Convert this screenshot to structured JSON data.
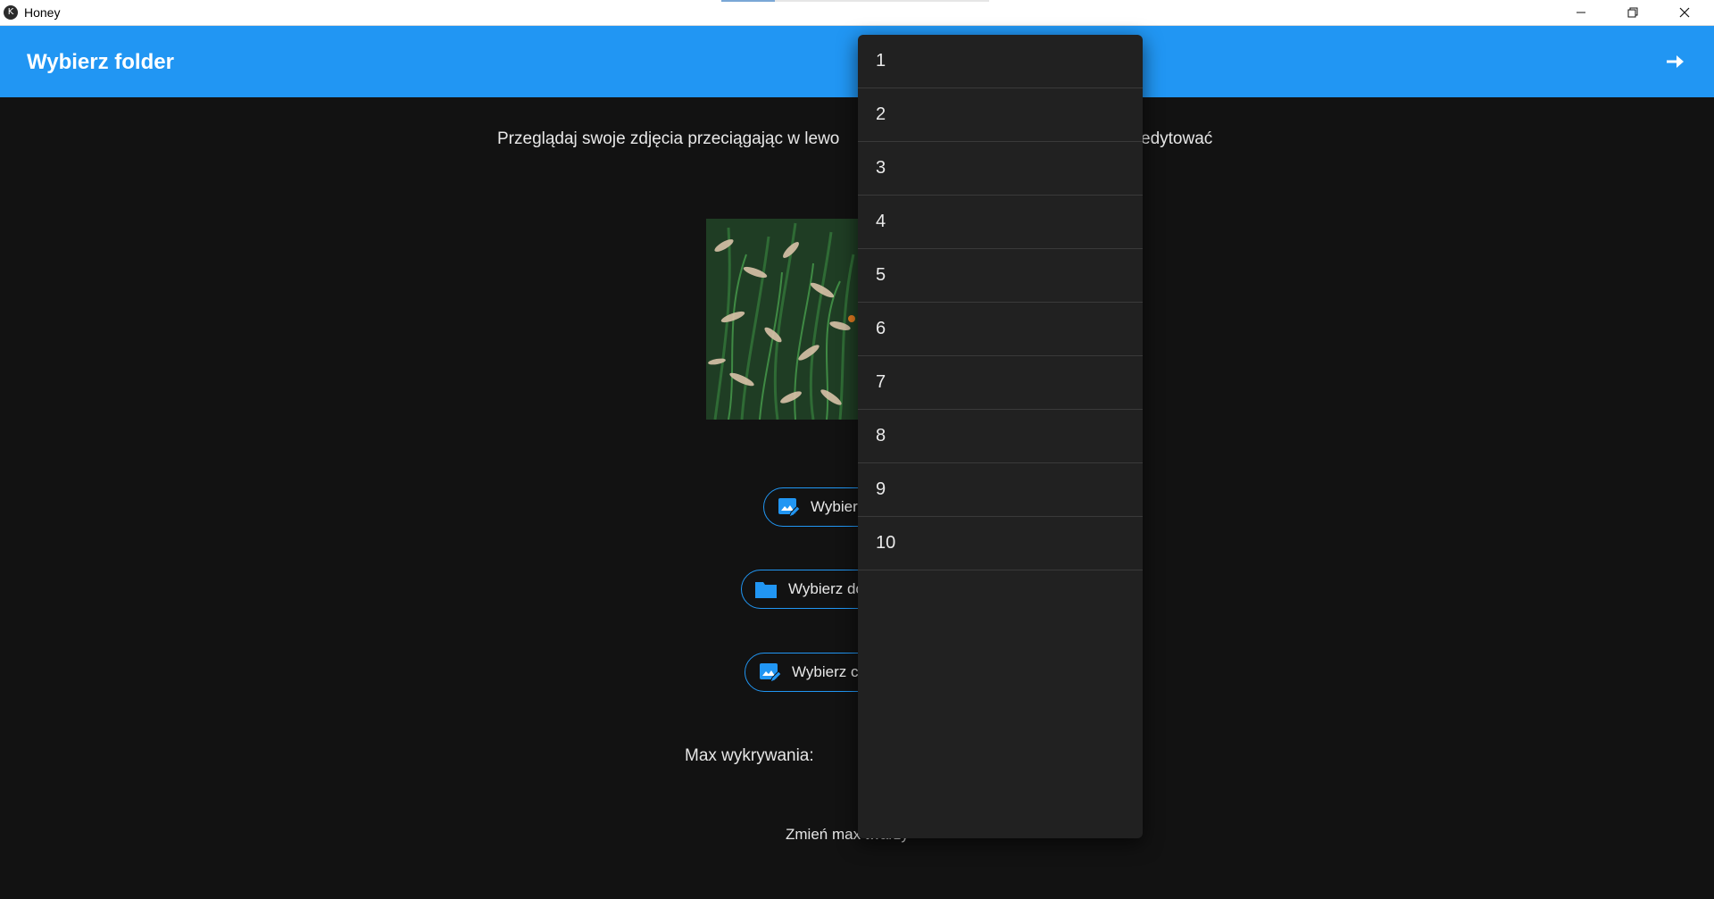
{
  "window": {
    "title": "Honey",
    "controls": [
      "minimize-icon",
      "restore-icon",
      "close-icon"
    ]
  },
  "appbar": {
    "title": "Wybierz folder",
    "next_icon": "arrow-right-icon",
    "color": "#2196f3"
  },
  "main": {
    "instruction_left": "Przeglądaj swoje zdjęcia przeciągając w lewo",
    "instruction_right": "edytować",
    "buttons": [
      {
        "label": "Wybierz",
        "icon": "edit-image-icon"
      },
      {
        "label": "Wybierz do",
        "icon": "folder-icon"
      },
      {
        "label": "Wybierz c",
        "icon": "edit-image-icon"
      }
    ],
    "max_label": "Max wykrywania:",
    "change_button": "Zmień max twarzy"
  },
  "dropdown": {
    "options": [
      "1",
      "2",
      "3",
      "4",
      "5",
      "6",
      "7",
      "8",
      "9",
      "10"
    ]
  }
}
